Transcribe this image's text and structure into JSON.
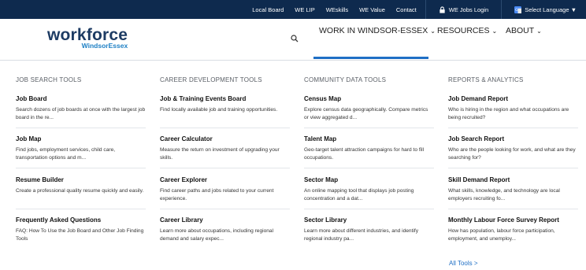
{
  "topbar": {
    "links": [
      "Local Board",
      "WE LIP",
      "WEskills",
      "WE Value",
      "Contact"
    ],
    "login_label": "WE Jobs Login",
    "language_label": "Select Language ▼"
  },
  "logo": {
    "line1": "workforce",
    "line2": "WindsorEssex"
  },
  "nav": {
    "work": "WORK IN WINDSOR-ESSEX",
    "resources": "RESOURCES",
    "about": "ABOUT",
    "chevron": "⌄"
  },
  "colors": {
    "topbar_bg": "#0e2a4e",
    "accent": "#1f6fc5",
    "logo_dark": "#1d3b63",
    "logo_blue": "#1d7fc4"
  },
  "columns": [
    {
      "heading": "JOB SEARCH TOOLS",
      "items": [
        {
          "title": "Job Board",
          "desc": "Search dozens of job boards at once with the largest job board in the re..."
        },
        {
          "title": "Job Map",
          "desc": "Find jobs, employment services, child care, transportation options and m..."
        },
        {
          "title": "Resume Builder",
          "desc": "Create a professional quality resume quickly and easily."
        },
        {
          "title": "Frequently Asked Questions",
          "desc": "FAQ: How To Use the Job Board and Other Job Finding Tools"
        }
      ]
    },
    {
      "heading": "CAREER DEVELOPMENT TOOLS",
      "items": [
        {
          "title": "Job & Training Events Board",
          "desc": "Find locally available job and training opportunities."
        },
        {
          "title": "Career Calculator",
          "desc": "Measure the return on investment of upgrading your skills."
        },
        {
          "title": "Career Explorer",
          "desc": "Find career paths and jobs related to your current experience."
        },
        {
          "title": "Career Library",
          "desc": "Learn more about occupations, including regional demand and salary expec..."
        }
      ]
    },
    {
      "heading": "COMMUNITY DATA TOOLS",
      "items": [
        {
          "title": "Census Map",
          "desc": "Explore census data geographically. Compare metrics or view aggregated d..."
        },
        {
          "title": "Talent Map",
          "desc": "Geo-target talent attraction campaigns for hard to fill occupations."
        },
        {
          "title": "Sector Map",
          "desc": "An online mapping tool that displays job posting concentration and a dat..."
        },
        {
          "title": "Sector Library",
          "desc": "Learn more about different industries, and identify regional industry pa..."
        }
      ]
    },
    {
      "heading": "REPORTS & ANALYTICS",
      "items": [
        {
          "title": "Job Demand Report",
          "desc": "Who is hiring in the region and what occupations are being recruited?"
        },
        {
          "title": "Job Search Report",
          "desc": "Who are the people looking for work, and what are they searching for?"
        },
        {
          "title": "Skill Demand Report",
          "desc": "What skills, knowledge, and technology are local employers recruiting fo..."
        },
        {
          "title": "Monthly Labour Force Survey Report",
          "desc": "How has population, labour force participation, employment, and unemploy..."
        }
      ]
    }
  ],
  "all_tools": "All Tools >"
}
